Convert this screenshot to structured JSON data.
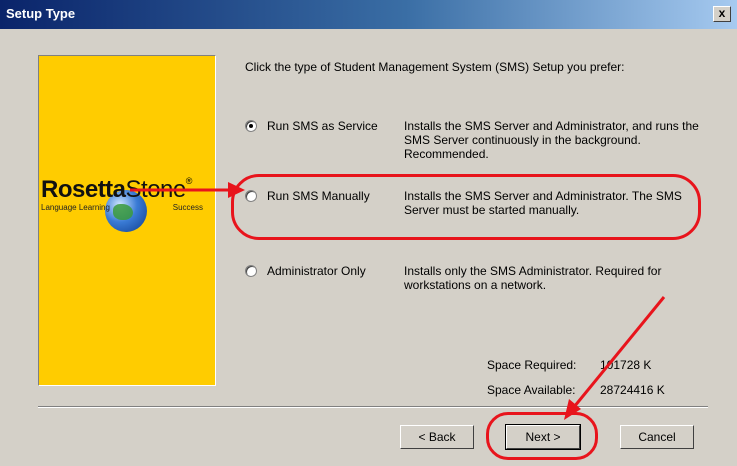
{
  "window": {
    "title": "Setup Type",
    "close_label": "x"
  },
  "banner": {
    "logo_word_1": "Rosetta",
    "logo_word_2": "Stone",
    "logo_mark": "®",
    "tagline_left": "Language Learning",
    "tagline_right": "Success"
  },
  "prompt": "Click the type of Student Management System (SMS) Setup you prefer:",
  "options": [
    {
      "label": "Run SMS as Service",
      "checked": true,
      "description": "Installs the SMS Server and Administrator, and runs the SMS Server continuously in the background.  Recommended."
    },
    {
      "label": "Run SMS Manually",
      "checked": false,
      "description": "Installs the SMS Server and Administrator. The SMS Server must be started manually."
    },
    {
      "label": "Administrator Only",
      "checked": false,
      "description": "Installs only the SMS Administrator.  Required for workstations on a network."
    }
  ],
  "space": {
    "required_label": "Space Required:",
    "required_value": "101728 K",
    "available_label": "Space Available:",
    "available_value": "28724416 K"
  },
  "buttons": {
    "back": "< Back",
    "next": "Next >",
    "cancel": "Cancel"
  },
  "annotation_color": "#e8141c"
}
